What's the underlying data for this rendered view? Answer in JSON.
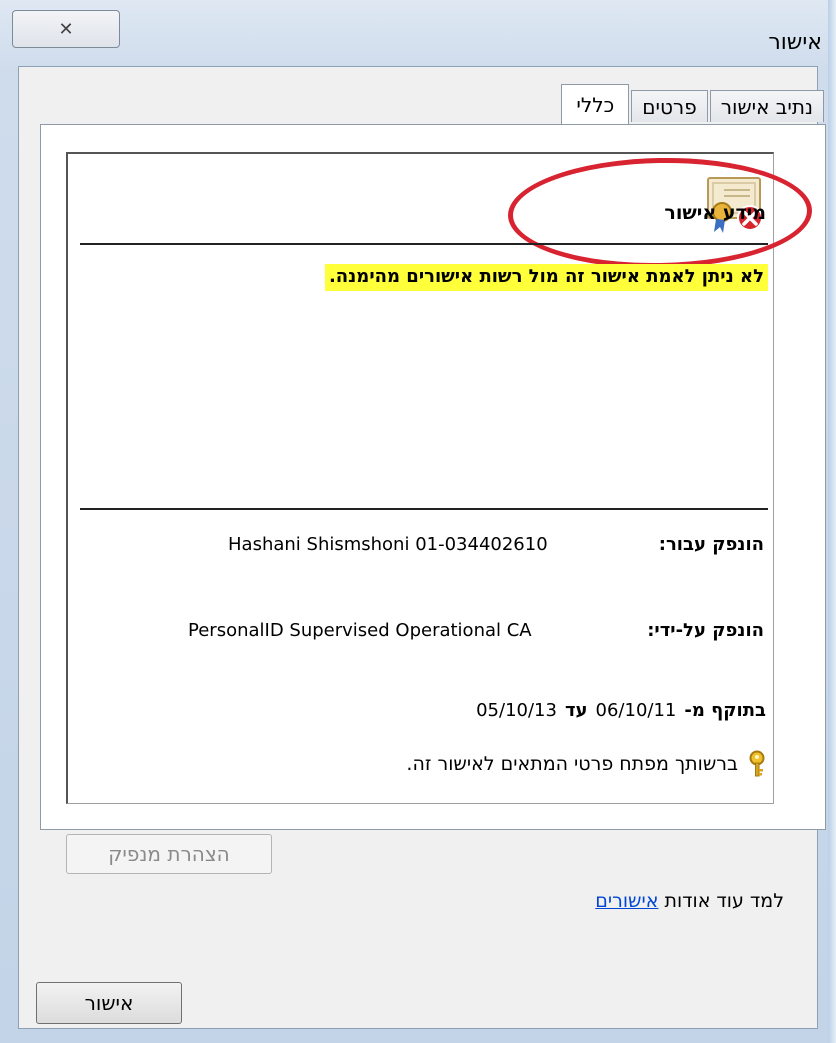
{
  "window": {
    "title": "אישור",
    "close_glyph": "✕"
  },
  "tabs": [
    {
      "label": "כללי",
      "active": true
    },
    {
      "label": "פרטים",
      "active": false
    },
    {
      "label": "נתיב אישור",
      "active": false
    }
  ],
  "cert": {
    "header": "מידע אישור",
    "icon": "certificate-error-icon",
    "warning": "לא ניתן לאמת אישור זה מול רשות אישורים מהימנה.",
    "issued_to_label": "הונפק עבור:",
    "issued_to_value": "Hashani Shismshoni 01-034402610",
    "issued_by_label": "הונפק על-ידי:",
    "issued_by_value": "PersonalID Supervised Operational CA",
    "valid_from_label": "בתוקף מ-",
    "valid_from": "06/10/11",
    "valid_to_label": "עד",
    "valid_to": "05/10/13",
    "private_key_text": "ברשותך מפתח פרטי המתאים לאישור זה."
  },
  "buttons": {
    "issuer_statement": "הצהרת מנפיק",
    "ok": "אישור"
  },
  "learn_more": {
    "prefix": "למד עוד אודות ",
    "link": "אישורים"
  },
  "colors": {
    "highlight": "#ffff3a",
    "annotation_circle": "#d82330",
    "link": "#0046d5"
  }
}
